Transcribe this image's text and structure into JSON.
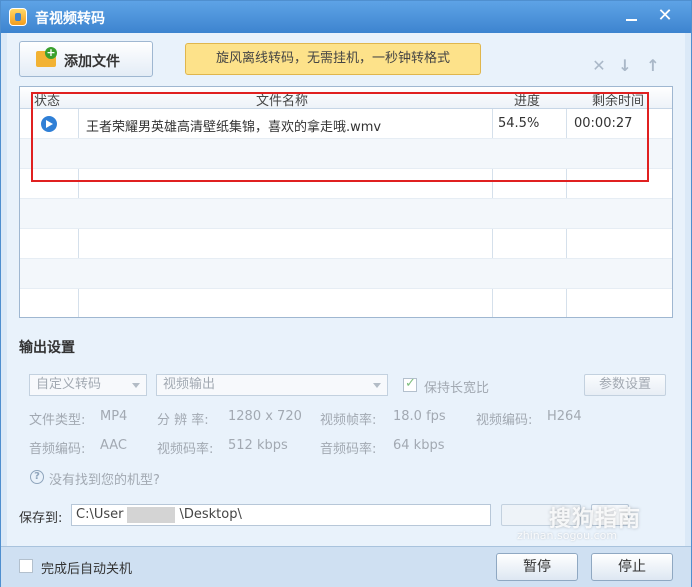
{
  "window": {
    "title": "音视频转码"
  },
  "toolbar": {
    "add_file_label": "添加文件",
    "promo_text": "旋风离线转码，无需挂机，一秒钟转格式"
  },
  "list": {
    "columns": {
      "status": "状态",
      "filename": "文件名称",
      "progress": "进度",
      "remaining": "剩余时间"
    },
    "rows": [
      {
        "filename": "王者荣耀男英雄高清壁纸集锦，喜欢的拿走哦.wmv",
        "progress": "54.5%",
        "remaining": "00:00:27"
      }
    ]
  },
  "output": {
    "section_title": "输出设置",
    "preset": "自定义转码",
    "format": "视频输出",
    "keep_ratio": "保持长宽比",
    "params_button": "参数设置",
    "file_type_label": "文件类型:",
    "file_type": "MP4",
    "resolution_label": "分 辨 率:",
    "resolution": "1280 x 720",
    "fps_label": "视频帧率:",
    "fps": "18.0 fps",
    "vcodec_label": "视频编码:",
    "vcodec": "H264",
    "acodec_label": "音频编码:",
    "acodec": "AAC",
    "vbitrate_label": "视频码率:",
    "vbitrate": "512 kbps",
    "abitrate_label": "音频码率:",
    "abitrate": "64 kbps",
    "help_link": "没有找到您的机型?"
  },
  "save": {
    "label": "保存到:",
    "path_start": "C:\\User",
    "path_end": "\\Desktop\\"
  },
  "footer": {
    "auto_shutdown": "完成后自动关机",
    "pause": "暂停",
    "stop": "停止"
  },
  "watermark": {
    "text": "搜狗指南",
    "url": "zhinan.sogou.com"
  }
}
